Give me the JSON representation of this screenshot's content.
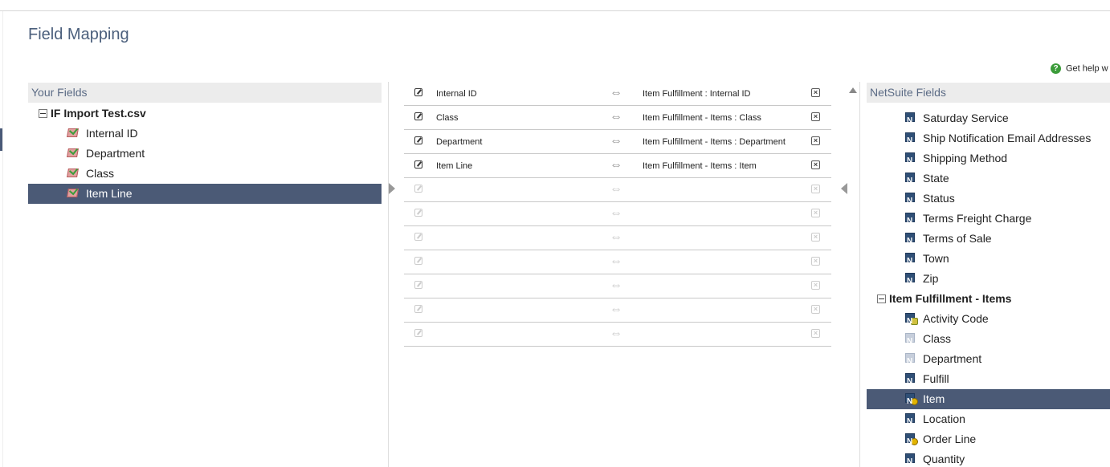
{
  "page": {
    "title": "Field Mapping",
    "help_label": "Get help w"
  },
  "your_fields": {
    "header": "Your Fields",
    "file": "IF Import Test.csv",
    "items": [
      "Internal ID",
      "Department",
      "Class",
      "Item Line"
    ],
    "selected": "Item Line"
  },
  "mappings": [
    {
      "your_field": "Internal ID",
      "netsuite_field": "Item Fulfillment : Internal ID"
    },
    {
      "your_field": "Class",
      "netsuite_field": "Item Fulfillment - Items : Class"
    },
    {
      "your_field": "Department",
      "netsuite_field": "Item Fulfillment - Items : Department"
    },
    {
      "your_field": "Item Line",
      "netsuite_field": "Item Fulfillment - Items : Item"
    }
  ],
  "empty_mapping_rows": 7,
  "netsuite_fields": {
    "header": "NetSuite Fields",
    "items_top": [
      "Saturday Service",
      "Ship Notification Email Addresses",
      "Shipping Method",
      "State",
      "Status",
      "Terms Freight Charge",
      "Terms of Sale",
      "Town",
      "Zip"
    ],
    "group": "Item Fulfillment - Items",
    "group_items": [
      {
        "label": "Activity Code",
        "icon": "field-locked-icon"
      },
      {
        "label": "Class",
        "icon": "field-disabled-icon"
      },
      {
        "label": "Department",
        "icon": "field-disabled-icon"
      },
      {
        "label": "Fulfill",
        "icon": "field-icon"
      },
      {
        "label": "Item",
        "icon": "field-key-icon",
        "selected": true
      },
      {
        "label": "Location",
        "icon": "field-icon"
      },
      {
        "label": "Order Line",
        "icon": "field-key-icon"
      },
      {
        "label": "Quantity",
        "icon": "field-icon"
      }
    ]
  },
  "colors": {
    "selected_bg": "#4b5a76",
    "title": "#4b5f7c",
    "header_bg": "#ececec"
  }
}
